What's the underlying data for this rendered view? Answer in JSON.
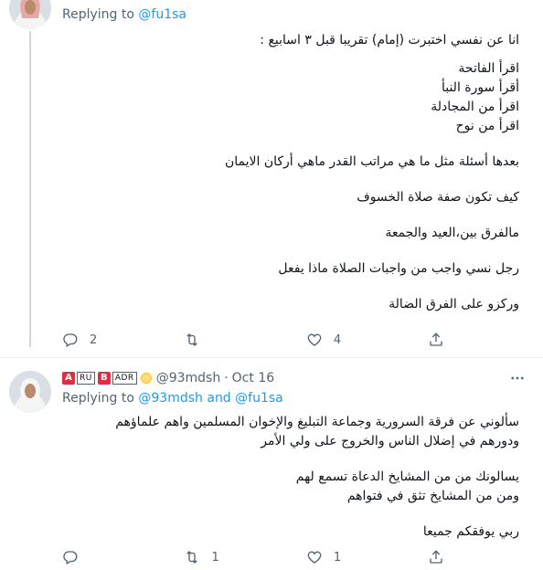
{
  "tweet1": {
    "replying_label": "Replying to",
    "replying_to": "@fu1sa",
    "lines": [
      "انا عن نفسي اختبرت (إمام) تقريبا قبل ٣ اسابيع :",
      "",
      "اقرأ الفاتحة",
      "أقرأ سورة النبأ",
      "اقرأ من المجادلة",
      "اقرأ من نوح",
      "",
      "بعدها أسئلة مثل ما هي مراتب القدر ماهي أركان الايمان",
      "",
      "كيف تكون صفة صلاة الخسوف",
      "",
      "مالفرق بين،العيد والجمعة",
      "",
      "رجل نسي واجب من واجبات الصلاة ماذا يفعل",
      "",
      "وركزو على الفرق الضالة"
    ],
    "replies": "2",
    "retweets": "",
    "likes": "4"
  },
  "tweet2": {
    "name_parts": [
      "A",
      "RU",
      "B",
      "ADR"
    ],
    "handle": "@93mdsh",
    "separator": "·",
    "date": "Oct 16",
    "replying_label": "Replying to",
    "replying_to_1": "@93mdsh",
    "replying_and": "and",
    "replying_to_2": "@fu1sa",
    "lines": [
      "سألوني عن فرقة السرورية وجماعة التبليغ والإخوان المسلمين واهم علماؤهم",
      "ودورهم في إضلال الناس والخروج على ولي الأمر",
      "",
      "يسالونك من من المشايخ الدعاة تسمع لهم",
      "ومن من المشايخ تثق في فتواهم",
      "",
      "ربي يوفقكم جميعا"
    ],
    "replies": "",
    "retweets": "1",
    "likes": "1"
  },
  "icons": {
    "reply": "reply-icon",
    "retweet": "retweet-icon",
    "like": "like-icon",
    "share": "share-icon",
    "more": "more-icon",
    "sun": "sun-emoji-icon"
  },
  "colors": {
    "link": "#1d9bf0",
    "secondary": "#536471",
    "text": "#0f1419",
    "badge_red": "#dd2e44"
  }
}
